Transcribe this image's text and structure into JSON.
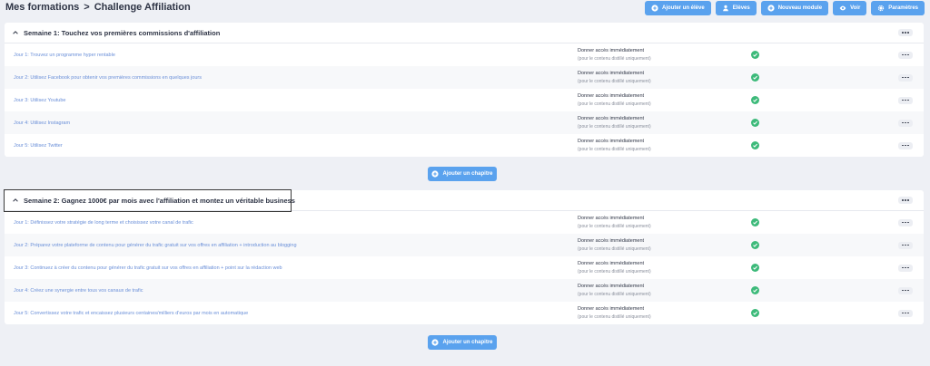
{
  "breadcrumb": {
    "parent": "Mes formations",
    "separator": ">",
    "current": "Challenge Affiliation"
  },
  "toolbar": {
    "buttons": [
      {
        "label": "Ajouter un élève",
        "icon": "plus-circle-icon"
      },
      {
        "label": "Elèves",
        "icon": "users-icon"
      },
      {
        "label": "Nouveau module",
        "icon": "plus-circle-icon"
      },
      {
        "label": "Voir",
        "icon": "eye-icon"
      },
      {
        "label": "Paramètres",
        "icon": "gear-icon"
      }
    ]
  },
  "sections": [
    {
      "title": "Semaine 1: Touchez vos premières commissions d'affiliation",
      "rows": [
        {
          "title": "Jour 1: Trouvez un programme hyper rentable",
          "access": "Donner accès immédiatement",
          "access_note": "(pour le contenu distillé uniquement)"
        },
        {
          "title": "Jour 2: Utilisez Facebook pour obtenir vos premières commissions en quelques jours",
          "access": "Donner accès immédiatement",
          "access_note": "(pour le contenu distillé uniquement)"
        },
        {
          "title": "Jour 3: Utilisez Youtube",
          "access": "Donner accès immédiatement",
          "access_note": "(pour le contenu distillé uniquement)"
        },
        {
          "title": "Jour 4: Utilisez Instagram",
          "access": "Donner accès immédiatement",
          "access_note": "(pour le contenu distillé uniquement)"
        },
        {
          "title": "Jour 5: Utilisez Twitter",
          "access": "Donner accès immédiatement",
          "access_note": "(pour le contenu distillé uniquement)"
        }
      ],
      "add_chapter": "Ajouter un chapitre"
    },
    {
      "title": "Semaine 2: Gagnez 1000€ par mois avec l'affiliation et montez un véritable business",
      "rows": [
        {
          "title": "Jour 1: Définissez votre stratégie de long terme et choisissez votre canal de trafic",
          "access": "Donner accès immédiatement",
          "access_note": "(pour le contenu distillé uniquement)"
        },
        {
          "title": "Jour 2: Préparez votre plateforme de contenu pour générer du trafic gratuit sur vos offres en affiliation + introduction au blogging",
          "access": "Donner accès immédiatement",
          "access_note": "(pour le contenu distillé uniquement)"
        },
        {
          "title": "Jour 3: Continuez à créer du contenu pour générer du trafic gratuit sur vos offres en affiliation + point sur la rédaction web",
          "access": "Donner accès immédiatement",
          "access_note": "(pour le contenu distillé uniquement)"
        },
        {
          "title": "Jour 4: Créez une synergie entre tous vos canaux de trafic",
          "access": "Donner accès immédiatement",
          "access_note": "(pour le contenu distillé uniquement)"
        },
        {
          "title": "Jour 5: Convertissez votre trafic et encaissez plusieurs centaines/milliers d'euros par mois en automatique",
          "access": "Donner accès immédiatement",
          "access_note": "(pour le contenu distillé uniquement)"
        }
      ],
      "add_chapter": "Ajouter un chapitre"
    }
  ],
  "colors": {
    "accent": "#5aa2ee",
    "check": "#3dba7a",
    "link": "#6a8fd8"
  }
}
